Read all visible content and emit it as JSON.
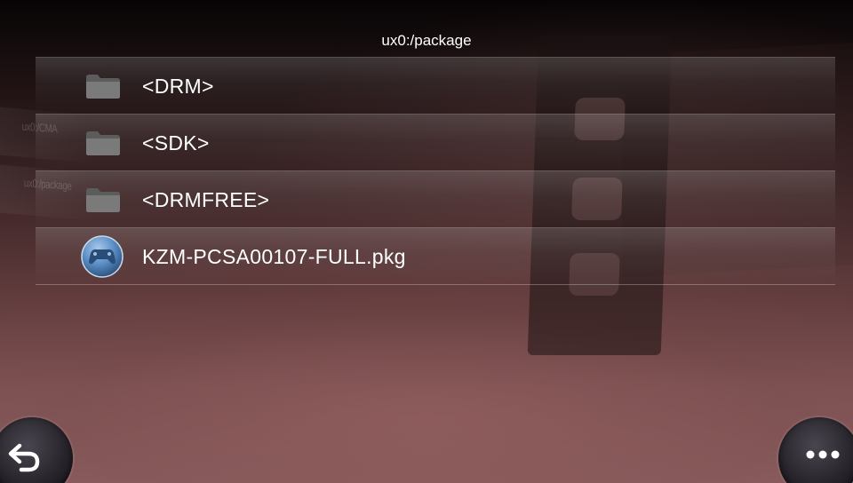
{
  "header": {
    "path": "ux0:/package"
  },
  "background": {
    "ghost_labels": [
      "ux0:/CMA",
      "ux0:/package"
    ]
  },
  "files": [
    {
      "label": "<DRM>",
      "type": "folder",
      "icon": "folder-icon"
    },
    {
      "label": "<SDK>",
      "type": "folder",
      "icon": "folder-icon"
    },
    {
      "label": "<DRMFREE>",
      "type": "folder",
      "icon": "folder-icon"
    },
    {
      "label": "KZM-PCSA00107-FULL.pkg",
      "type": "package",
      "icon": "gamepad-icon"
    }
  ],
  "controls": {
    "back_icon": "back-arrow-icon",
    "menu_icon": "more-dots-icon"
  },
  "colors": {
    "text": "#ffffff",
    "folder": "#6f6f6f",
    "package_icon": "#5b8fc6"
  }
}
